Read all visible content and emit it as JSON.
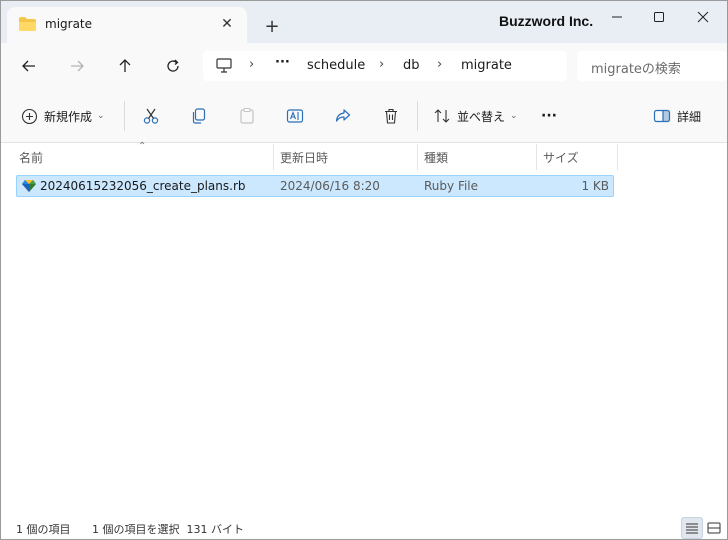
{
  "tab": {
    "title": "migrate",
    "close": "✕",
    "new_tab": "+"
  },
  "watermark": "Buzzword Inc.",
  "window_controls": {
    "minimize": "minimize-icon",
    "maximize": "maximize-icon",
    "close": "close-icon"
  },
  "nav": {
    "back": "back-arrow-icon",
    "forward": "forward-arrow-icon",
    "up": "up-arrow-icon",
    "refresh": "refresh-icon"
  },
  "address": {
    "overflow": "···",
    "crumbs": [
      "schedule",
      "db",
      "migrate"
    ],
    "separator": "›"
  },
  "search": {
    "placeholder": "migrateの検索"
  },
  "toolbar": {
    "new_label": "新規作成",
    "sort_label": "並べ替え",
    "more": "···",
    "details_label": "詳細",
    "chevron": "⌄"
  },
  "columns": {
    "name": "名前",
    "modified": "更新日時",
    "type": "種類",
    "size": "サイズ",
    "sort_caret": "⌃"
  },
  "files": [
    {
      "name": "20240615232056_create_plans.rb",
      "modified": "2024/06/16 8:20",
      "type": "Ruby File",
      "size": "1 KB"
    }
  ],
  "status": {
    "count": "1 個の項目",
    "selected": "1 個の項目を選択  131 バイト"
  },
  "colors": {
    "selection_bg": "#cce8ff",
    "selection_border": "#99d1ff",
    "titlebar_bg": "#e9eef5"
  }
}
